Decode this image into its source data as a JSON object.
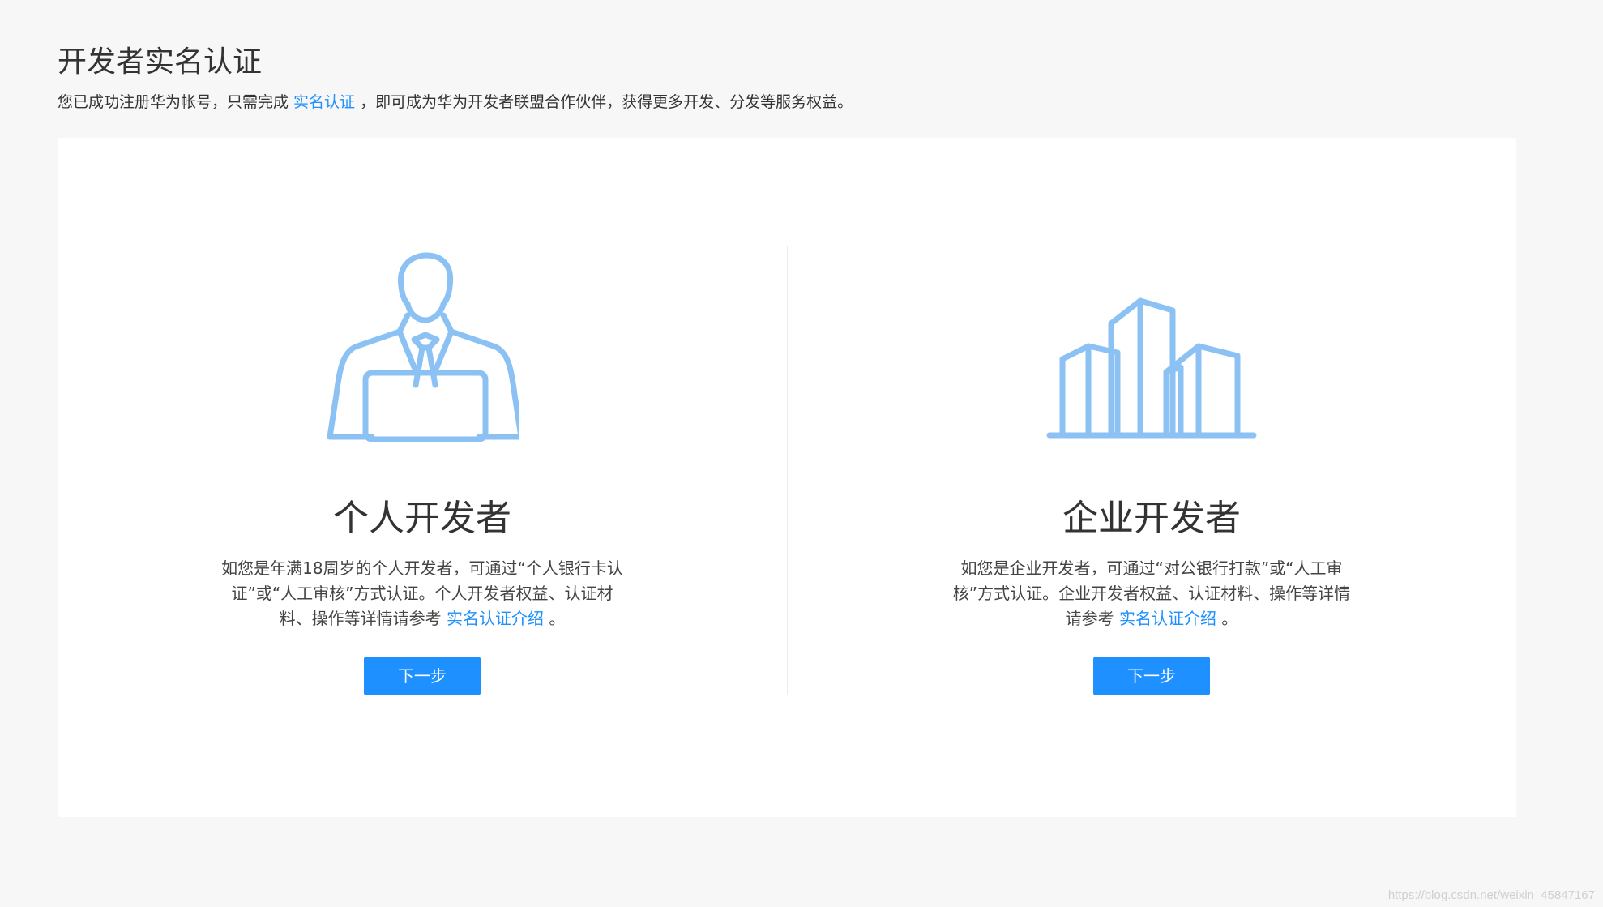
{
  "header": {
    "title": "开发者实名认证",
    "subtitle_before": "您已成功注册华为帐号，只需完成 ",
    "subtitle_link": "实名认证",
    "subtitle_after": " ，即可成为华为开发者联盟合作伙伴，获得更多开发、分发等服务权益。"
  },
  "panels": [
    {
      "title": "个人开发者",
      "icon": "person-laptop-icon",
      "desc_before": "如您是年满18周岁的个人开发者，可通过“个人银行卡认证”或“人工审核”方式认证。个人开发者权益、认证材料、操作等详情请参考 ",
      "desc_link": "实名认证介绍",
      "desc_after": " 。",
      "button_label": "下一步"
    },
    {
      "title": "企业开发者",
      "icon": "buildings-icon",
      "desc_before": "如您是企业开发者，可通过“对公银行打款”或“人工审核”方式认证。企业开发者权益、认证材料、操作等详情请参考 ",
      "desc_link": "实名认证介绍",
      "desc_after": " 。",
      "button_label": "下一步"
    }
  ],
  "watermark": "https://blog.csdn.net/weixin_45847167",
  "colors": {
    "accent": "#1e90ff",
    "icon": "#8cc1f4",
    "background": "#f7f7f7"
  }
}
